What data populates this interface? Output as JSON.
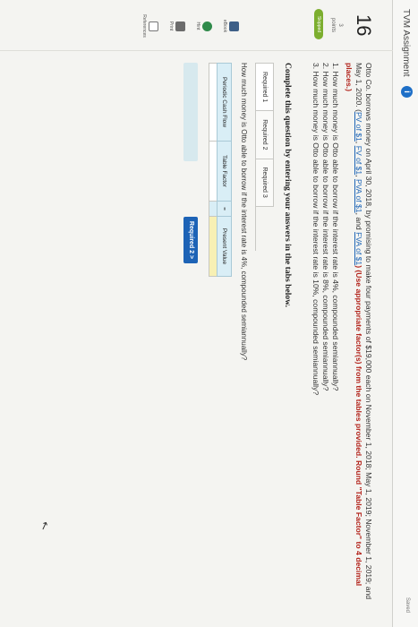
{
  "header": {
    "title": "TVM Assignment",
    "info_icon": "i",
    "saved": "Saved"
  },
  "question": {
    "number": "16",
    "points_value": "3",
    "points_label": "points",
    "status_badge": "Skipped",
    "problem_text_1": "Otto Co. borrows money on April 30, 2018, by promising to make four payments of $19,000 each on November 1, 2018; May 1, 2019; November 1, 2019; and May 1, 2020.",
    "links_prefix": "(",
    "link_pv": "PV of $1",
    "link_fv": "FV of $1",
    "link_pva": "PVA of $1",
    "and": "and",
    "link_fva": "FVA of $1",
    "use_table_note": ") (Use appropriate factor(s) from the tables provided.",
    "round_note": "Round \"Table Factor\" to 4 decimal places.)",
    "q1": "1. How much money is Otto able to borrow if the interest rate is 4%, compounded semiannually?",
    "q2": "2. How much money is Otto able to borrow if the interest rate is 8%, compounded semiannually?",
    "q3": "3. How much money is Otto able to borrow if the interest rate is 10%, compounded semiannually?"
  },
  "sidebar": {
    "ebook": "eBook",
    "hint": "Hint",
    "print": "Print",
    "references": "References"
  },
  "answer": {
    "instruction": "Complete this question by entering your answers in the tabs below.",
    "tabs": [
      "Required 1",
      "Required 2",
      "Required 3"
    ],
    "subquestion": "How much money is Otto able to borrow if the interest rate is 4%, compounded semiannually?",
    "table_headers": [
      "Periodic Cash Flow",
      "Table Factor",
      "Present Value"
    ],
    "table_operator": "=",
    "prev_button": "< Required 1",
    "next_button": "Required 2  >"
  },
  "colors": {
    "accent": "#1d63b6",
    "skipped": "#7cae2e",
    "emphasis_red": "#b3261e"
  }
}
